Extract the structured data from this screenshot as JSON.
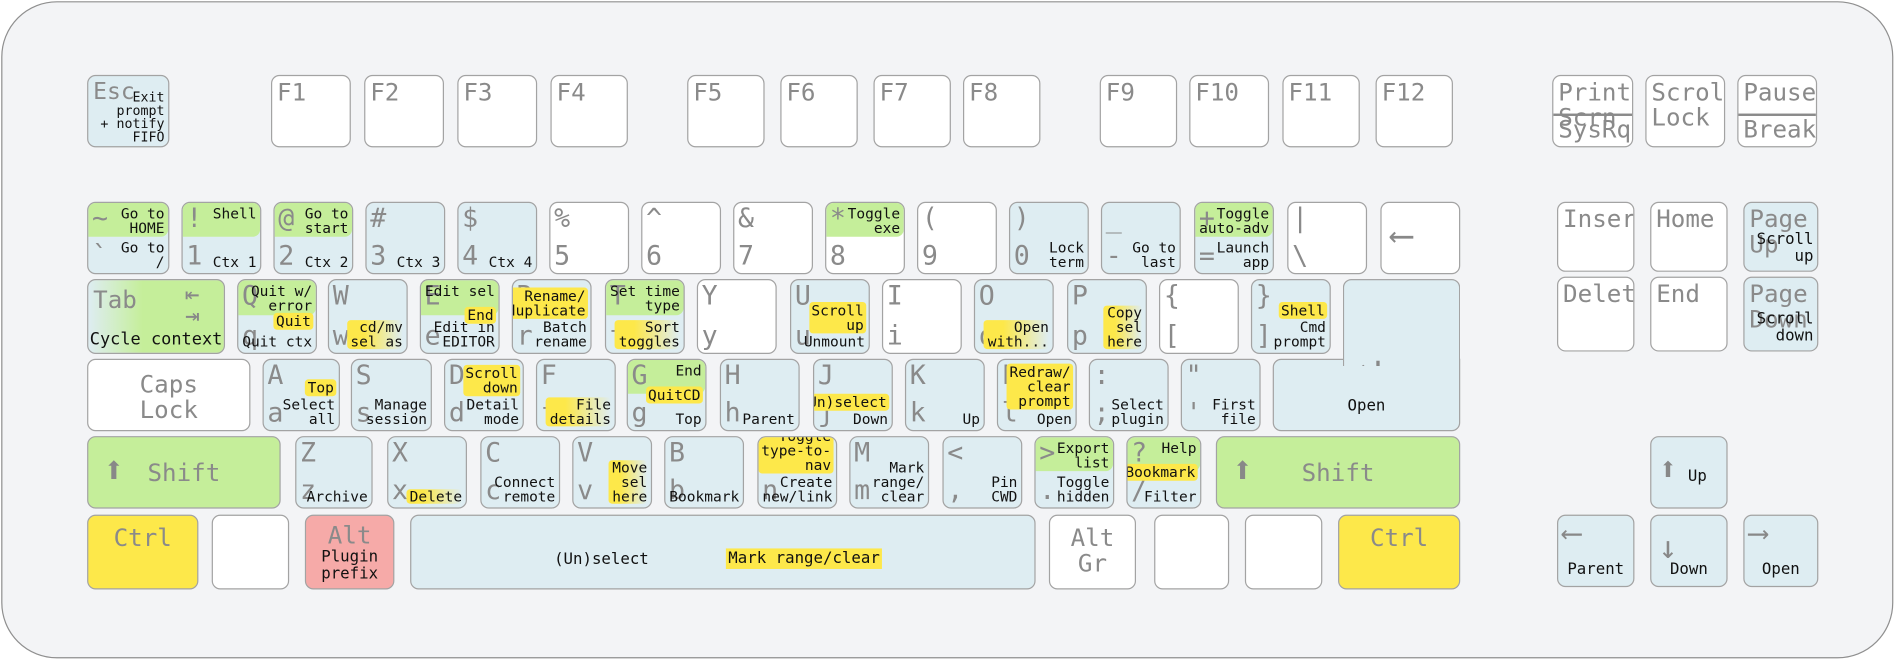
{
  "colors": {
    "shift_green": "#c5ee9a",
    "ctrl_yellow": "#fde84a",
    "alt_pink": "#f6aaa8",
    "mapped_blue": "#deedf2",
    "unmapped_white": "#ffffff"
  },
  "keys": [
    {
      "id": "esc",
      "type": "label",
      "color": "blue",
      "label": "Esc",
      "action": "Exit\nprompt\n+ notify\nFIFO"
    },
    {
      "id": "f1",
      "type": "label",
      "color": "white",
      "label": "F1"
    },
    {
      "id": "f2",
      "type": "label",
      "color": "white",
      "label": "F2"
    },
    {
      "id": "f3",
      "type": "label",
      "color": "white",
      "label": "F3"
    },
    {
      "id": "f4",
      "type": "label",
      "color": "white",
      "label": "F4"
    },
    {
      "id": "f5",
      "type": "label",
      "color": "white",
      "label": "F5"
    },
    {
      "id": "f6",
      "type": "label",
      "color": "white",
      "label": "F6"
    },
    {
      "id": "f7",
      "type": "label",
      "color": "white",
      "label": "F7"
    },
    {
      "id": "f8",
      "type": "label",
      "color": "white",
      "label": "F8"
    },
    {
      "id": "f9",
      "type": "label",
      "color": "white",
      "label": "F9"
    },
    {
      "id": "f10",
      "type": "label",
      "color": "white",
      "label": "F10"
    },
    {
      "id": "f11",
      "type": "label",
      "color": "white",
      "label": "F11"
    },
    {
      "id": "f12",
      "type": "label",
      "color": "white",
      "label": "F12"
    },
    {
      "id": "printscreen",
      "type": "split",
      "color": "white",
      "label": "Print\nScrn",
      "label2": "SysRq"
    },
    {
      "id": "scrolllock",
      "type": "label",
      "color": "white",
      "label": "Scroll\nLock"
    },
    {
      "id": "pause",
      "type": "split",
      "color": "white",
      "label": "Pause",
      "label2": "Break"
    },
    {
      "id": "grave",
      "type": "std",
      "color": "blue",
      "shift": "~",
      "shift_action": "Go to\nHOME",
      "base": "`",
      "base_action": "Go to\n/"
    },
    {
      "id": "1",
      "type": "std",
      "color": "blue",
      "shift": "!",
      "shift_action": "Shell",
      "base": "1",
      "base_action": "Ctx 1"
    },
    {
      "id": "2",
      "type": "std",
      "color": "blue",
      "shift": "@",
      "shift_action": "Go to\nstart",
      "base": "2",
      "base_action": "Ctx 2"
    },
    {
      "id": "3",
      "type": "std",
      "color": "blue",
      "shift": "#",
      "base": "3",
      "base_action": "Ctx 3"
    },
    {
      "id": "4",
      "type": "std",
      "color": "blue",
      "shift": "$",
      "base": "4",
      "base_action": "Ctx 4"
    },
    {
      "id": "5",
      "type": "std",
      "color": "white",
      "shift": "%",
      "base": "5"
    },
    {
      "id": "6",
      "type": "std",
      "color": "white",
      "shift": "^",
      "base": "6"
    },
    {
      "id": "7",
      "type": "std",
      "color": "white",
      "shift": "&",
      "base": "7"
    },
    {
      "id": "8",
      "type": "std",
      "color": "white",
      "shift": "*",
      "shift_action": "Toggle\nexe",
      "base": "8"
    },
    {
      "id": "9",
      "type": "std",
      "color": "white",
      "shift": "(",
      "base": "9"
    },
    {
      "id": "0",
      "type": "std",
      "color": "blue",
      "shift": ")",
      "base": "0",
      "base_action": "Lock\nterm"
    },
    {
      "id": "minus",
      "type": "std",
      "color": "blue",
      "shift": "_",
      "base": "-",
      "base_action": "Go to\nlast"
    },
    {
      "id": "equal",
      "type": "std",
      "color": "blue",
      "shift": "+",
      "shift_action": "Toggle\nauto-adv",
      "base": "=",
      "base_action": "Launch\napp"
    },
    {
      "id": "backslash",
      "type": "std",
      "color": "white",
      "shift": "|",
      "base": "\\"
    },
    {
      "id": "backspace",
      "type": "icon",
      "color": "white",
      "icon": "arrow-left"
    },
    {
      "id": "tab",
      "type": "tab",
      "color": "green",
      "label": "Tab",
      "action": "Cycle context",
      "icon": "tab-arrows"
    },
    {
      "id": "q",
      "type": "std",
      "color": "blue",
      "shift": "Q",
      "shift_action": "Quit w/\nerror",
      "ctrl_action": "Quit",
      "base": "q",
      "base_action": "Quit ctx"
    },
    {
      "id": "w",
      "type": "std",
      "color": "blue",
      "shift": "W",
      "base": "w",
      "base_action": "cd/mv\nsel as",
      "base_hl": "fade"
    },
    {
      "id": "e",
      "type": "std",
      "color": "blue",
      "shift": "E",
      "shift_action": "Edit sel",
      "ctrl_action": "End",
      "base": "e",
      "base_action": "Edit in\nEDITOR"
    },
    {
      "id": "r",
      "type": "std",
      "color": "blue",
      "shift": "R",
      "ctrl_action": "Rename/\nduplicate",
      "base": "r",
      "base_action": "Batch\nrename"
    },
    {
      "id": "t",
      "type": "std",
      "color": "blue",
      "shift": "T",
      "shift_action": "Set time\ntype",
      "base": "t",
      "base_action": "Sort\ntoggles",
      "base_hl": "fade"
    },
    {
      "id": "y",
      "type": "std",
      "color": "white",
      "shift": "Y",
      "base": "y"
    },
    {
      "id": "u",
      "type": "std",
      "color": "blue",
      "shift": "U",
      "ctrl_action": "Scroll\nup",
      "base": "u",
      "base_action": "Unmount"
    },
    {
      "id": "i",
      "type": "std",
      "color": "white",
      "shift": "I",
      "base": "i"
    },
    {
      "id": "o",
      "type": "std",
      "color": "blue",
      "shift": "O",
      "base": "o",
      "base_action": "Open\nwith...",
      "base_hl": "fade"
    },
    {
      "id": "p",
      "type": "std",
      "color": "blue",
      "shift": "P",
      "base": "p",
      "base_action": "Copy\nsel\nhere",
      "base_hl": "fade"
    },
    {
      "id": "bracketleft",
      "type": "std",
      "color": "white",
      "shift": "{",
      "base": "["
    },
    {
      "id": "bracketright",
      "type": "std",
      "color": "blue",
      "shift": "}",
      "ctrl_action": "Shell",
      "base": "]",
      "base_action": "Cmd\nprompt"
    },
    {
      "id": "capslock",
      "type": "label",
      "color": "white",
      "label": "Caps\nLock",
      "center": true
    },
    {
      "id": "a",
      "type": "std",
      "color": "blue",
      "shift": "A",
      "ctrl_action": "Top",
      "base": "a",
      "base_action": "Select\nall"
    },
    {
      "id": "s",
      "type": "std",
      "color": "blue",
      "shift": "S",
      "base": "s",
      "base_action": "Manage\nsession"
    },
    {
      "id": "d",
      "type": "std",
      "color": "blue",
      "shift": "D",
      "ctrl_action": "Scroll\ndown",
      "base": "d",
      "base_action": "Detail\nmode"
    },
    {
      "id": "f",
      "type": "std",
      "color": "blue",
      "shift": "F",
      "base": "f",
      "base_action": "File\ndetails",
      "base_hl": "fade"
    },
    {
      "id": "g",
      "type": "std",
      "color": "blue",
      "shift": "G",
      "shift_action": "End",
      "ctrl_action": "QuitCD",
      "base": "g",
      "base_action": "Top"
    },
    {
      "id": "h",
      "type": "std",
      "color": "blue",
      "shift": "H",
      "base": "h",
      "base_action": "Parent"
    },
    {
      "id": "j",
      "type": "std",
      "color": "blue",
      "shift": "J",
      "ctrl_action": "(Un)select",
      "base": "j",
      "base_action": "Down"
    },
    {
      "id": "k",
      "type": "std",
      "color": "blue",
      "shift": "K",
      "base": "k",
      "base_action": "Up"
    },
    {
      "id": "l",
      "type": "std",
      "color": "blue",
      "shift": "L",
      "ctrl_action": "Redraw/\nclear\nprompt",
      "base": "l",
      "base_action": "Open"
    },
    {
      "id": "semicolon",
      "type": "std",
      "color": "blue",
      "shift": ":",
      "base": ";",
      "base_action": "Select\nplugin"
    },
    {
      "id": "quote",
      "type": "std",
      "color": "blue",
      "shift": "\"",
      "base": "'",
      "base_action": "First\nfile"
    },
    {
      "id": "enter",
      "type": "enter",
      "color": "blue",
      "action": "Open",
      "icon": "enter-arrow"
    },
    {
      "id": "lshift",
      "type": "shift",
      "color": "green",
      "label": "Shift",
      "icon": "arrow-up"
    },
    {
      "id": "z",
      "type": "std",
      "color": "blue",
      "shift": "Z",
      "base": "z",
      "base_action": "Archive"
    },
    {
      "id": "x",
      "type": "std",
      "color": "blue",
      "shift": "X",
      "base": "x",
      "base_action": "Delete",
      "base_hl": "fade"
    },
    {
      "id": "c",
      "type": "std",
      "color": "blue",
      "shift": "C",
      "base": "c",
      "base_action": "Connect\nremote"
    },
    {
      "id": "v",
      "type": "std",
      "color": "blue",
      "shift": "V",
      "base": "v",
      "base_action": "Move\nsel\nhere",
      "base_hl": "fade"
    },
    {
      "id": "b",
      "type": "std",
      "color": "blue",
      "shift": "B",
      "base": "b",
      "base_action": "Bookmark"
    },
    {
      "id": "n",
      "type": "std",
      "color": "blue",
      "shift": "N",
      "ctrl_action": "Toggle\ntype-to-nav",
      "base": "n",
      "base_action": "Create\nnew/link"
    },
    {
      "id": "m",
      "type": "std",
      "color": "blue",
      "shift": "M",
      "base": "m",
      "base_action": "Mark\nrange/\nclear"
    },
    {
      "id": "comma",
      "type": "std",
      "color": "blue",
      "shift": "<",
      "base": ",",
      "base_action": "Pin\nCWD"
    },
    {
      "id": "period",
      "type": "std",
      "color": "blue",
      "shift": ">",
      "shift_action": "Export\nlist",
      "base": ".",
      "base_action": "Toggle\nhidden"
    },
    {
      "id": "slash",
      "type": "std",
      "color": "blue",
      "shift": "?",
      "shift_action": "Help",
      "ctrl_action": "Bookmark",
      "base": "/",
      "base_action": "Filter"
    },
    {
      "id": "rshift",
      "type": "shift",
      "color": "green",
      "label": "Shift",
      "icon": "arrow-up"
    },
    {
      "id": "lctrl",
      "type": "label",
      "color": "yellow",
      "label": "Ctrl",
      "center": true
    },
    {
      "id": "lsuper",
      "type": "label",
      "color": "white",
      "label": ""
    },
    {
      "id": "lalt",
      "type": "label",
      "color": "pink",
      "label": "Alt",
      "action": "Plugin\nprefix",
      "center": true
    },
    {
      "id": "space",
      "type": "space",
      "color": "blue",
      "action": "(Un)select",
      "ctrl_action": "Mark range/clear"
    },
    {
      "id": "altgr",
      "type": "label",
      "color": "white",
      "label": "Alt Gr",
      "center": true
    },
    {
      "id": "rsuper",
      "type": "label",
      "color": "white",
      "label": ""
    },
    {
      "id": "menu",
      "type": "label",
      "color": "white",
      "label": ""
    },
    {
      "id": "rctrl",
      "type": "label",
      "color": "yellow",
      "label": "Ctrl",
      "center": true
    },
    {
      "id": "insert",
      "type": "label",
      "color": "white",
      "label": "Insert"
    },
    {
      "id": "home",
      "type": "label",
      "color": "white",
      "label": "Home"
    },
    {
      "id": "pageup",
      "type": "label",
      "color": "blue",
      "label": "Page\nUp",
      "action": "Scroll\nup",
      "right": true
    },
    {
      "id": "delete",
      "type": "label",
      "color": "white",
      "label": "Delete"
    },
    {
      "id": "end",
      "type": "label",
      "color": "white",
      "label": "End"
    },
    {
      "id": "pagedown",
      "type": "label",
      "color": "blue",
      "label": "Page\nDown",
      "action": "Scroll\ndown",
      "right": true
    },
    {
      "id": "up",
      "type": "arrow",
      "color": "blue",
      "icon": "arrow-up",
      "action": "Up"
    },
    {
      "id": "left",
      "type": "arrow",
      "color": "blue",
      "icon": "arrow-left",
      "action": "Parent"
    },
    {
      "id": "down",
      "type": "arrow",
      "color": "blue",
      "icon": "arrow-down",
      "action": "Down"
    },
    {
      "id": "right",
      "type": "arrow",
      "color": "blue",
      "icon": "arrow-right",
      "action": "Open"
    }
  ]
}
